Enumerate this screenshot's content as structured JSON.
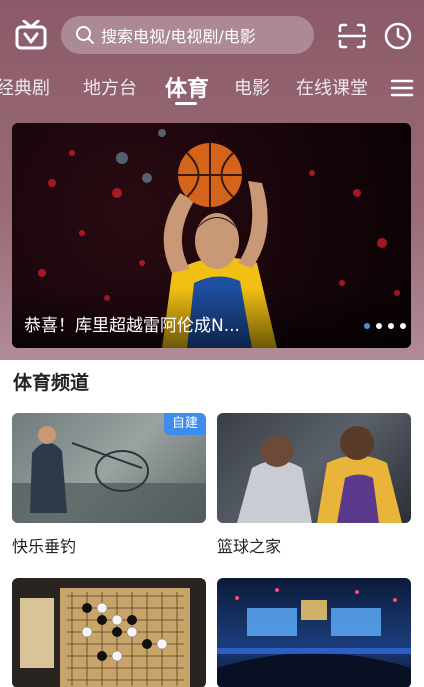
{
  "search": {
    "placeholder": "搜索电视/电视剧/电影"
  },
  "tabs": [
    {
      "label": "经典剧"
    },
    {
      "label": "地方台"
    },
    {
      "label": "体育"
    },
    {
      "label": "电影"
    },
    {
      "label": "在线课堂"
    }
  ],
  "active_tab": "体育",
  "banner": {
    "caption": "恭喜！库里超越雷阿伦成N...",
    "dot_count": 4,
    "active_dot": 0
  },
  "section": {
    "title": "体育频道"
  },
  "channels": [
    {
      "label": "快乐垂钓",
      "badge": "自建"
    },
    {
      "label": "篮球之家",
      "badge": ""
    },
    {
      "label": "",
      "badge": ""
    },
    {
      "label": "",
      "badge": ""
    }
  ],
  "colors": {
    "header": "#8a5a68",
    "accent": "#4a90e2",
    "badge": "#3d8cf0"
  },
  "icons": [
    "tv-icon",
    "search-icon",
    "scan-icon",
    "clock-icon",
    "menu-icon"
  ]
}
